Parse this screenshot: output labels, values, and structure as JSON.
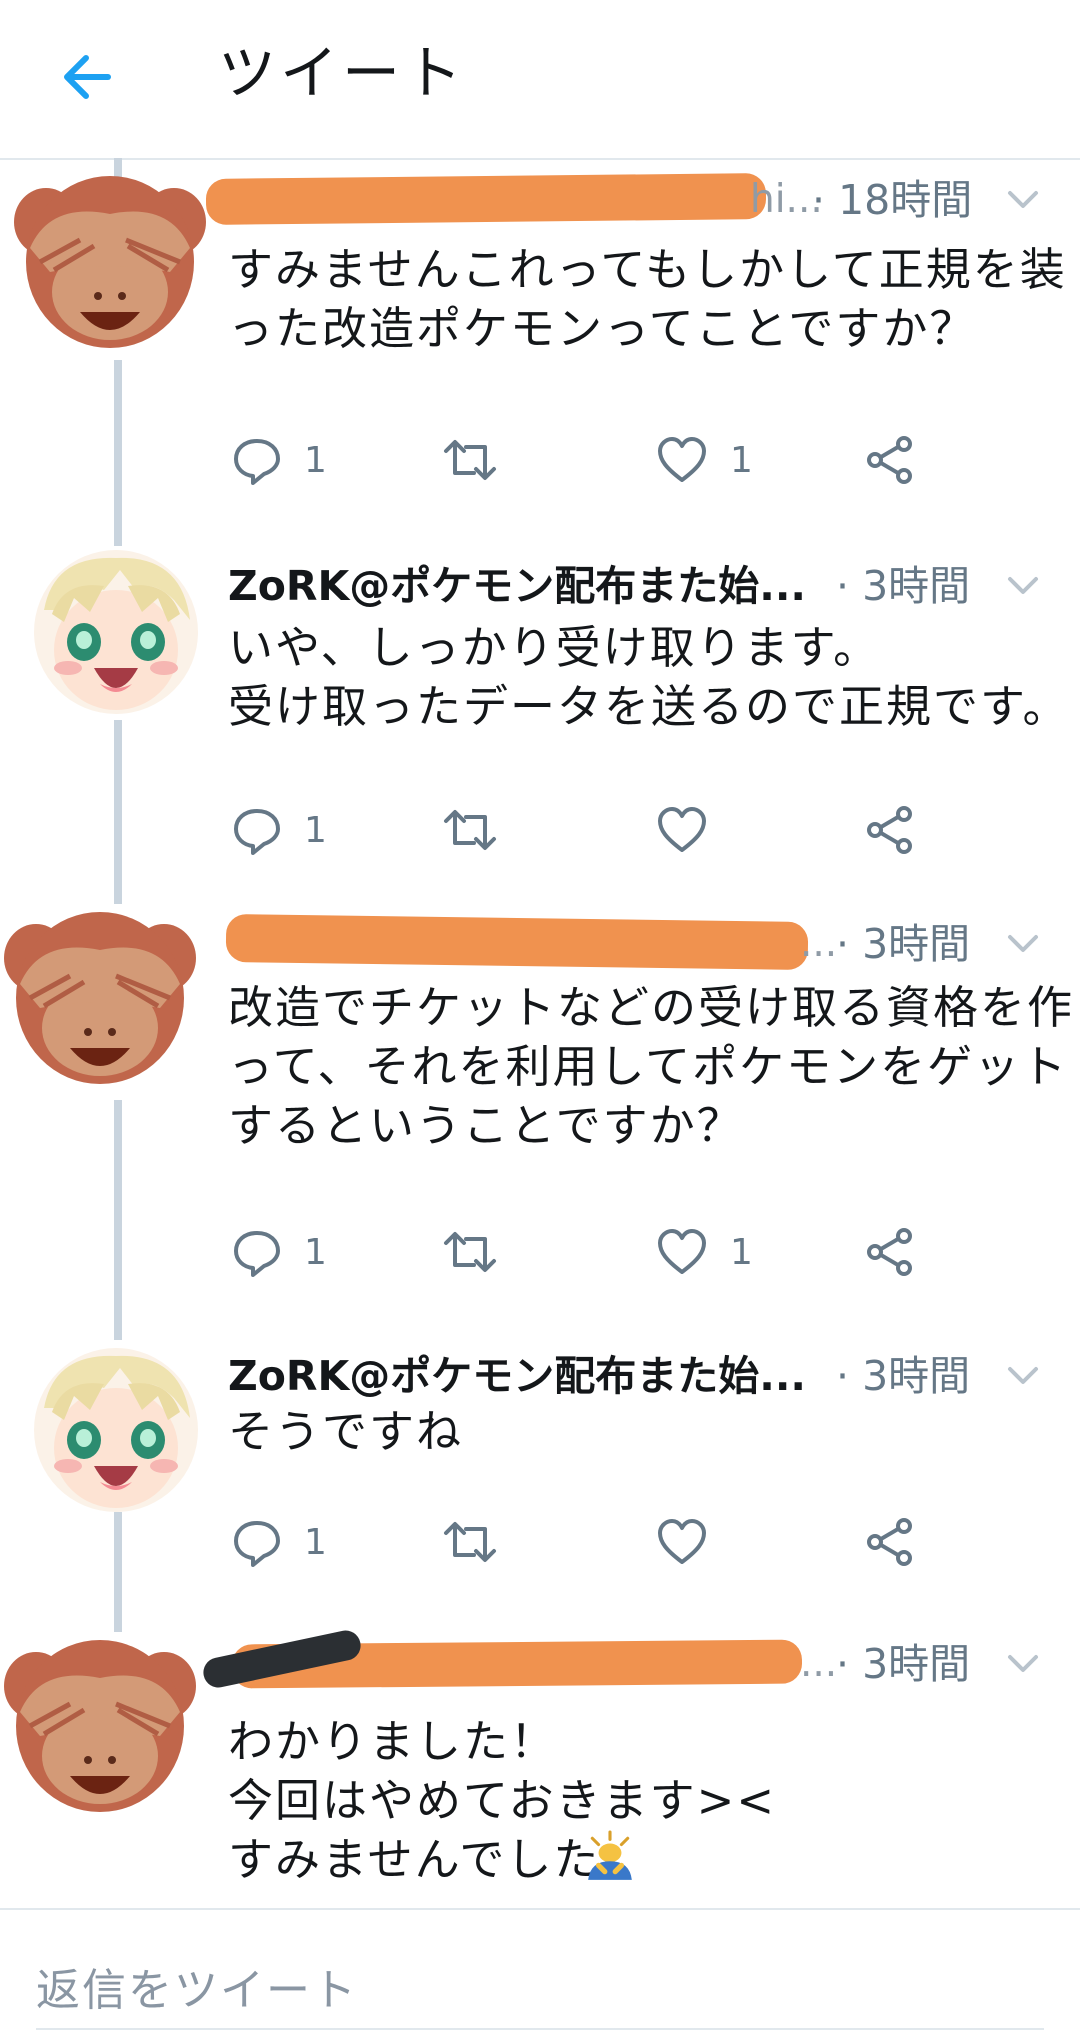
{
  "header": {
    "back_icon": "arrow-left-icon",
    "title": "ツイート",
    "accent_color": "#1da1f2"
  },
  "tweets": [
    {
      "author": "",
      "author_suffix": "hi...",
      "time": "· 18時間",
      "lines": "すみませんこれってもしかして正規を装\nった改造ポケモンってことですか？",
      "reply_count": "1",
      "like_count": "1",
      "avatar_icon": "see-no-evil-monkey-icon"
    },
    {
      "author": "ZoRK@ポケモン配布また始...",
      "time": "· 3時間",
      "lines": "いや、しっかり受け取ります。\n受け取ったデータを送るので正規です。",
      "reply_count": "1",
      "like_count": "",
      "avatar_icon": "anime-avatar-icon"
    },
    {
      "author": "",
      "author_suffix": "...",
      "time": "· 3時間",
      "lines": "改造でチケットなどの受け取る資格を作\nって、それを利用してポケモンをゲット\nするということですか？",
      "reply_count": "1",
      "like_count": "1",
      "avatar_icon": "see-no-evil-monkey-icon"
    },
    {
      "author": "ZoRK@ポケモン配布また始...",
      "time": "· 3時間",
      "lines": "そうですね",
      "reply_count": "1",
      "like_count": "",
      "avatar_icon": "anime-avatar-icon"
    },
    {
      "author": "",
      "author_suffix": "...",
      "time": "· 3時間",
      "lines": "わかりました！\n今回はやめておきます><\nすみませんでした",
      "reply_count": "",
      "like_count": "",
      "avatar_icon": "see-no-evil-monkey-icon",
      "trailing_emoji": "person-bowing-icon"
    }
  ],
  "reply_bar": {
    "placeholder": "返信をツイート"
  }
}
